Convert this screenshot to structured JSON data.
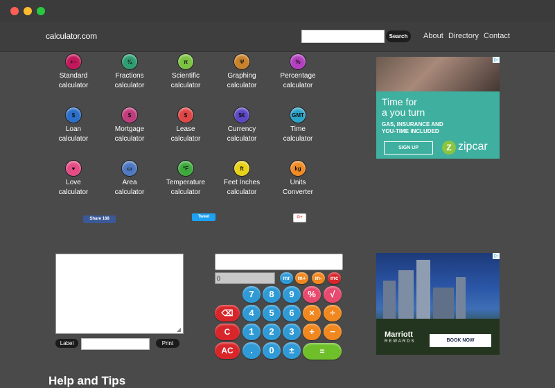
{
  "window": {
    "dots": [
      "#ff5f57",
      "#febc2e",
      "#28c840"
    ]
  },
  "navbar": {
    "brand": "calculator.com",
    "search_placeholder": "",
    "search_button": "Search",
    "links": [
      "About",
      "Directory",
      "Contact"
    ]
  },
  "calculators": [
    {
      "label1": "Standard",
      "label2": "calculator",
      "icon": "standard-icon",
      "color": "#c2185b",
      "glyph": "+−"
    },
    {
      "label1": "Fractions",
      "label2": "calculator",
      "icon": "fractions-icon",
      "color": "#2e9d72",
      "glyph": "¾"
    },
    {
      "label1": "Scientific",
      "label2": "calculator",
      "icon": "scientific-icon",
      "color": "#7cc242",
      "glyph": "π"
    },
    {
      "label1": "Graphing",
      "label2": "calculator",
      "icon": "graphing-icon",
      "color": "#c9822b",
      "glyph": "Ψ"
    },
    {
      "label1": "Percentage",
      "label2": "calculator",
      "icon": "percentage-icon",
      "color": "#b43fc0",
      "glyph": "%"
    },
    {
      "label1": "Loan",
      "label2": "calculator",
      "icon": "loan-icon",
      "color": "#2a6fc9",
      "glyph": "$"
    },
    {
      "label1": "Mortgage",
      "label2": "calculator",
      "icon": "mortgage-icon",
      "color": "#c03d7d",
      "glyph": "$"
    },
    {
      "label1": "Lease",
      "label2": "calculator",
      "icon": "lease-icon",
      "color": "#e04646",
      "glyph": "$"
    },
    {
      "label1": "Currency",
      "label2": "calculator",
      "icon": "currency-icon",
      "color": "#5b48c4",
      "glyph": "$€"
    },
    {
      "label1": "Time",
      "label2": "calculator",
      "icon": "time-icon",
      "color": "#2aa3c9",
      "glyph": "GMT"
    },
    {
      "label1": "Love",
      "label2": "calculator",
      "icon": "love-icon",
      "color": "#e54c84",
      "glyph": "♥"
    },
    {
      "label1": "Area",
      "label2": "calculator",
      "icon": "area-icon",
      "color": "#4f79c0",
      "glyph": "▭"
    },
    {
      "label1": "Temperature",
      "label2": "calculator",
      "icon": "temperature-icon",
      "color": "#3eaa3e",
      "glyph": "°F"
    },
    {
      "label1": "Feet Inches",
      "label2": "calculator",
      "icon": "feet-inches-icon",
      "color": "#e8d21a",
      "glyph": "ft"
    },
    {
      "label1": "Units",
      "label2": "Converter",
      "icon": "units-icon",
      "color": "#ef8a24",
      "glyph": "kg"
    }
  ],
  "share": {
    "facebook": "Share 168",
    "twitter": "Tweet",
    "google": "G+"
  },
  "ads": {
    "zipcar": {
      "headline1": "Time for",
      "headline2": "a you turn",
      "sub1": "GAS, INSURANCE AND",
      "sub2": "YOU-TIME INCLUDED",
      "cta": "SIGN UP",
      "brand": "zipcar",
      "adchoice": "▷"
    },
    "marriott": {
      "brand": "Marriott",
      "sub": "REWARDS",
      "cta": "BOOK NOW",
      "adchoice": "▷"
    }
  },
  "notepad": {
    "label_button": "Label",
    "print_button": "Print",
    "label_value": ""
  },
  "calculator_widget": {
    "display": "",
    "memory_display": "0",
    "memory_keys": [
      "mr",
      "m+",
      "m-",
      "mc"
    ],
    "keys": {
      "k7": "7",
      "k8": "8",
      "k9": "9",
      "pct": "%",
      "sqrt": "√",
      "back": "⌫",
      "k4": "4",
      "k5": "5",
      "k6": "6",
      "mul": "×",
      "div": "÷",
      "c": "C",
      "k1": "1",
      "k2": "2",
      "k3": "3",
      "plus": "+",
      "minus": "−",
      "ac": "AC",
      "dot": ".",
      "k0": "0",
      "pm": "±",
      "eq": "="
    }
  },
  "help": {
    "title": "Help and Tips"
  }
}
